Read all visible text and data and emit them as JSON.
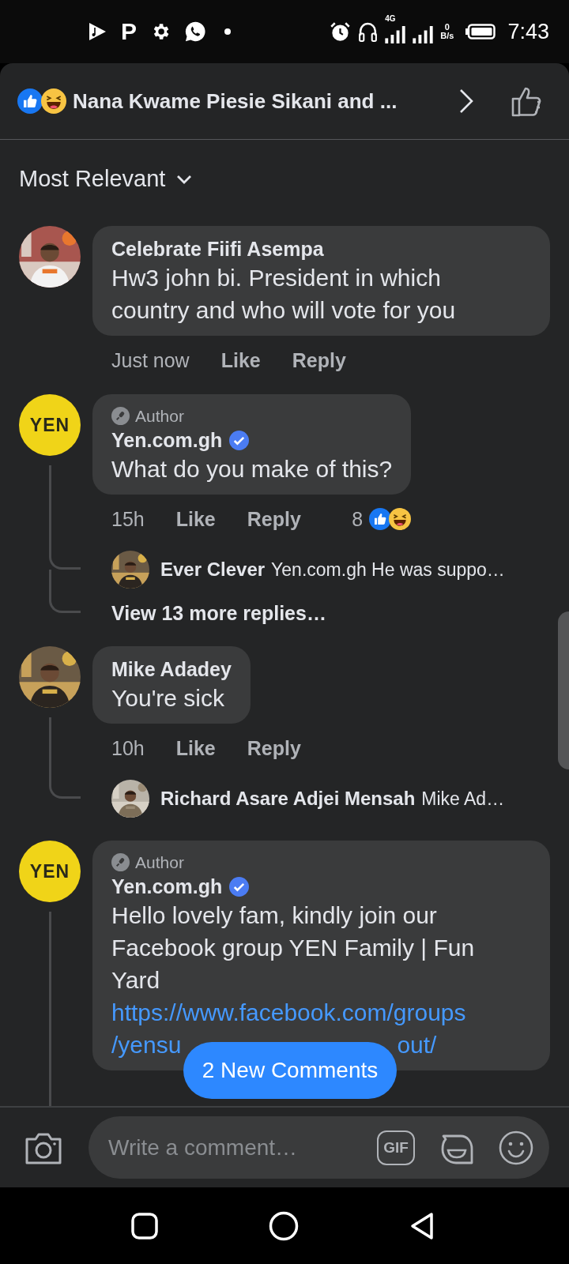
{
  "status_bar": {
    "app_letter": "P",
    "network": "4G",
    "speed_value": "0",
    "speed_unit": "B/s",
    "time": "7:43"
  },
  "header": {
    "reactions": [
      {
        "kind": "like"
      },
      {
        "kind": "haha"
      }
    ],
    "title": "Nana Kwame Piesie Sikani and ..."
  },
  "sort": {
    "label": "Most Relevant"
  },
  "comments": [
    {
      "avatar": {
        "kind": "picture"
      },
      "name": "Celebrate Fiifi Asempa",
      "verified": false,
      "body": "Hw3 john bi. President in which country and who will vote for you",
      "time": "Just now",
      "like": "Like",
      "reply": "Reply",
      "thread_line": false
    },
    {
      "avatar": {
        "kind": "logo",
        "label": "YEN"
      },
      "badge": "Author",
      "name": "Yen.com.gh",
      "verified": true,
      "body": "What do you make of this?",
      "time": "15h",
      "like": "Like",
      "reply": "Reply",
      "reaction_count": "8",
      "reactions": [
        {
          "kind": "like"
        },
        {
          "kind": "haha"
        }
      ],
      "thread_line": true,
      "replies": [
        {
          "name": "Ever Clever",
          "text": "Yen.com.gh He was suppo…"
        }
      ],
      "more_replies": "View 13 more replies…"
    },
    {
      "avatar": {
        "kind": "picture"
      },
      "name": "Mike Adadey",
      "verified": false,
      "body": "You're sick",
      "time": "10h",
      "like": "Like",
      "reply": "Reply",
      "thread_line": true,
      "replies": [
        {
          "name": "Richard Asare Adjei Mensah",
          "text": "Mike Ad…"
        }
      ]
    },
    {
      "avatar": {
        "kind": "logo",
        "label": "YEN"
      },
      "badge": "Author",
      "name": "Yen.com.gh",
      "verified": true,
      "body": "Hello lovely fam, kindly join our Facebook group YEN Family | Fun Yard",
      "link": [
        [
          "https://www.facebook.com/groups"
        ],
        [
          "/yensu",
          "out/"
        ]
      ],
      "thread_line": true
    }
  ],
  "new_comments_button": "2 New Comments",
  "composer": {
    "placeholder": "Write a comment…",
    "gif_label": "GIF"
  }
}
